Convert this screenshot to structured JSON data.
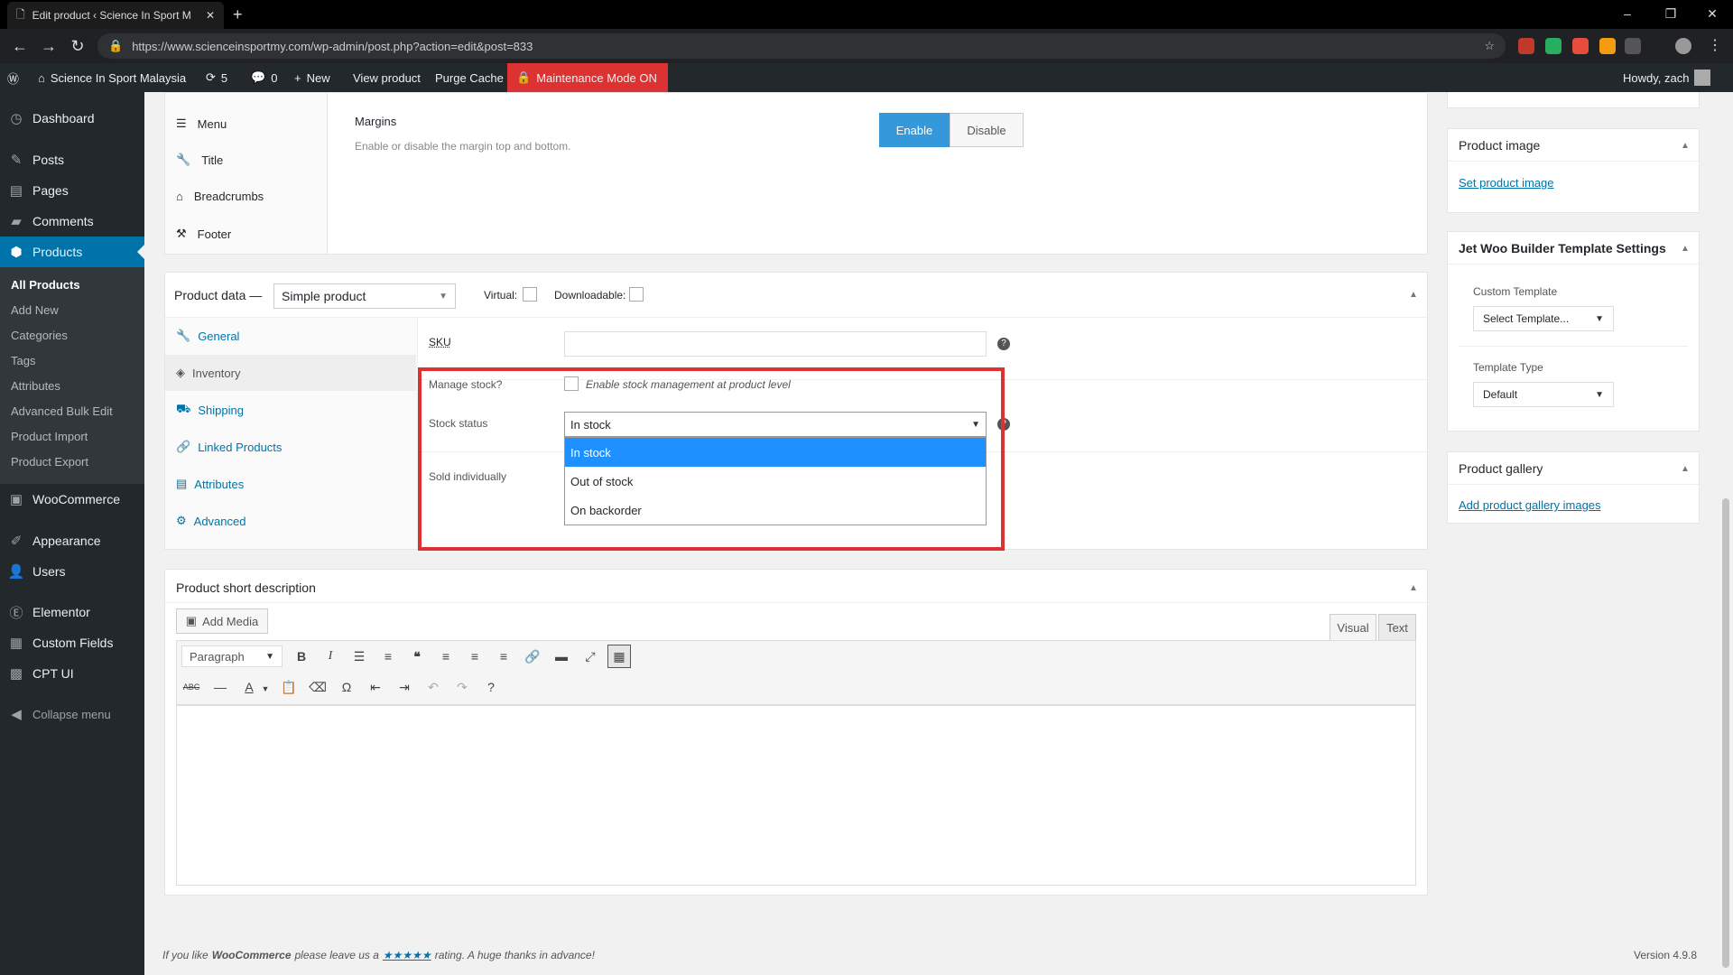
{
  "browser": {
    "tab_title": "Edit product ‹ Science In Sport M",
    "url": "https://www.scienceinsportmy.com/wp-admin/post.php?action=edit&post=833"
  },
  "adminbar": {
    "site": "Science In Sport Malaysia",
    "updates": "5",
    "comments": "0",
    "new": "New",
    "view": "View product",
    "purge": "Purge Cache",
    "maintenance": "Maintenance Mode ON",
    "howdy": "Howdy, zach"
  },
  "sidebar": {
    "dashboard": "Dashboard",
    "posts": "Posts",
    "pages": "Pages",
    "comments": "Comments",
    "products": "Products",
    "sub": [
      "All Products",
      "Add New",
      "Categories",
      "Tags",
      "Attributes",
      "Advanced Bulk Edit",
      "Product Import",
      "Product Export"
    ],
    "woocommerce": "WooCommerce",
    "appearance": "Appearance",
    "users": "Users",
    "elementor": "Elementor",
    "custom_fields": "Custom Fields",
    "cpt_ui": "CPT UI",
    "collapse": "Collapse menu"
  },
  "settings_panel": {
    "items": [
      "Menu",
      "Title",
      "Breadcrumbs",
      "Footer"
    ],
    "margins_title": "Margins",
    "margins_desc": "Enable or disable the margin top and bottom.",
    "enable": "Enable",
    "disable": "Disable"
  },
  "product_data": {
    "label": "Product data —",
    "type": "Simple product",
    "virtual": "Virtual:",
    "downloadable": "Downloadable:",
    "tabs": [
      "General",
      "Inventory",
      "Shipping",
      "Linked Products",
      "Attributes",
      "Advanced"
    ],
    "sku_label": "SKU",
    "sku_value": "",
    "manage_stock_label": "Manage stock?",
    "manage_stock_desc": "Enable stock management at product level",
    "stock_status_label": "Stock status",
    "stock_status_value": "In stock",
    "stock_options": [
      "In stock",
      "Out of stock",
      "On backorder"
    ],
    "sold_individually_label": "Sold individually"
  },
  "short_desc": {
    "title": "Product short description",
    "add_media": "Add Media",
    "visual": "Visual",
    "text": "Text",
    "format": "Paragraph"
  },
  "right": {
    "product_image_title": "Product image",
    "set_image": "Set product image",
    "jet_title": "Jet Woo Builder Template Settings",
    "custom_template_label": "Custom Template",
    "custom_template_value": "Select Template...",
    "template_type_label": "Template Type",
    "template_type_value": "Default",
    "gallery_title": "Product gallery",
    "add_gallery": "Add product gallery images"
  },
  "footer": {
    "text_before": "If you like",
    "woo": "WooCommerce",
    "text_mid": "please leave us a",
    "stars": "★★★★★",
    "text_after": "rating. A huge thanks in advance!",
    "version": "Version 4.9.8"
  },
  "colors": {
    "accent": "#0073aa",
    "highlight": "#dc3232",
    "selected": "#1e90ff"
  }
}
